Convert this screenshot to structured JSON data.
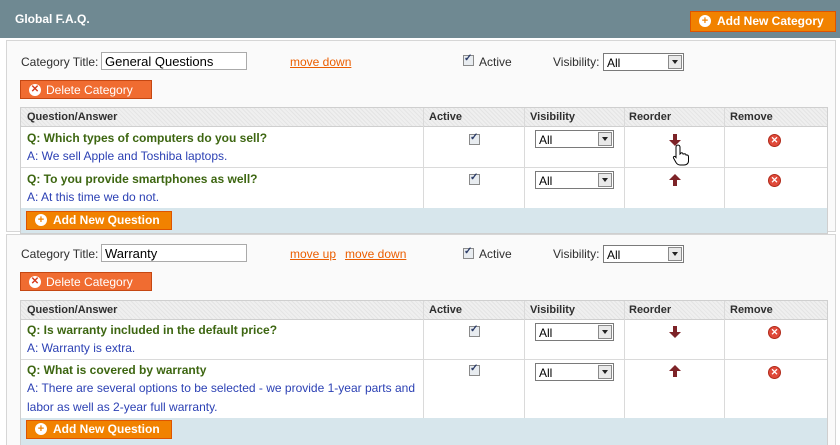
{
  "header": {
    "title": "Global F.A.Q.",
    "add_category_label": "Add New Category"
  },
  "columns": {
    "qa": "Question/Answer",
    "active": "Active",
    "visibility": "Visibility",
    "reorder": "Reorder",
    "remove": "Remove"
  },
  "common": {
    "category_title_label": "Category Title:",
    "active_label": "Active",
    "visibility_label": "Visibility:",
    "delete_label": "Delete Category",
    "add_question_label": "Add New Question",
    "move_up": "move up",
    "move_down": "move down"
  },
  "categories": [
    {
      "title": "General Questions",
      "visibility": "All",
      "active": true,
      "questions": [
        {
          "q": "Q: Which types of computers do you sell?",
          "a": "A: We sell Apple and Toshiba laptops.",
          "active": true,
          "visibility": "All",
          "reorder": "down"
        },
        {
          "q": "Q: To you provide smartphones as well?",
          "a": "A: At this time we do not.",
          "active": true,
          "visibility": "All",
          "reorder": "up"
        }
      ]
    },
    {
      "title": "Warranty",
      "visibility": "All",
      "active": true,
      "questions": [
        {
          "q": "Q: Is warranty included in the default price?",
          "a": "A: Warranty is extra.",
          "active": true,
          "visibility": "All",
          "reorder": "down"
        },
        {
          "q": "Q: What is covered by warranty",
          "a1": "A: There are several options to be selected - we provide 1-year parts and",
          "a2": "labor as well as 2-year full warranty.",
          "active": true,
          "visibility": "All",
          "reorder": "up"
        }
      ]
    }
  ],
  "colors": {
    "header_bg": "#6f8992",
    "button_orange": "#f18200",
    "question_green": "#3d6611",
    "answer_blue": "#2c41b4",
    "link_orange": "#eb5e00"
  }
}
